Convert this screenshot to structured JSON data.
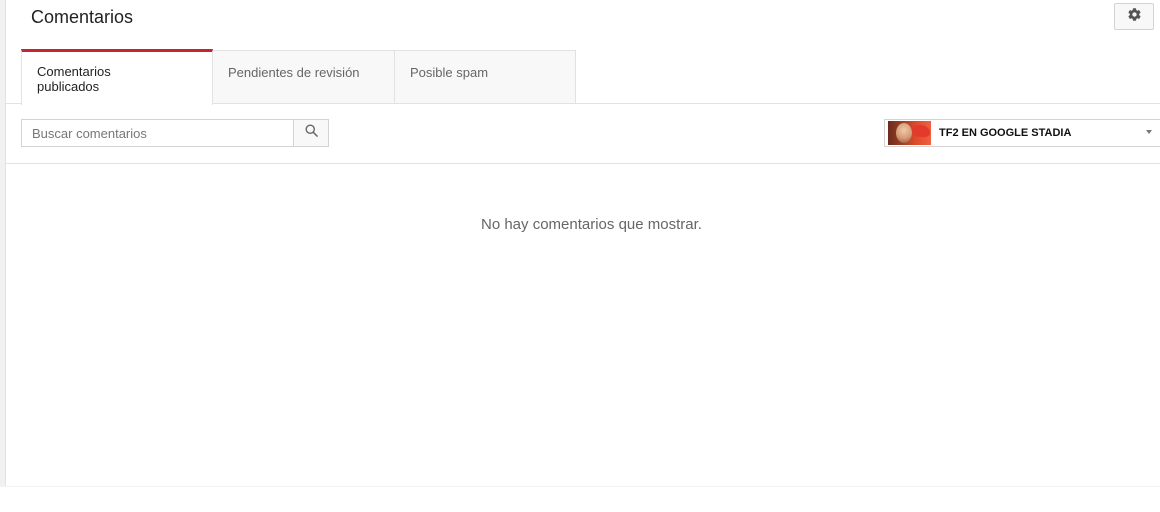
{
  "header": {
    "title": "Comentarios",
    "settings_icon": "gear-icon"
  },
  "tabs": [
    {
      "label": "Comentarios publicados",
      "active": true
    },
    {
      "label": "Pendientes de revisión",
      "active": false
    },
    {
      "label": "Posible spam",
      "active": false
    }
  ],
  "filters": {
    "search_placeholder": "Buscar comentarios",
    "search_value": "",
    "search_icon": "search-icon",
    "video_selected": "TF2 EN GOOGLE STADIA"
  },
  "content": {
    "empty_message": "No hay comentarios que mostrar."
  },
  "colors": {
    "active_tab_accent": "#c0282e",
    "border": "#e2e2e2"
  }
}
